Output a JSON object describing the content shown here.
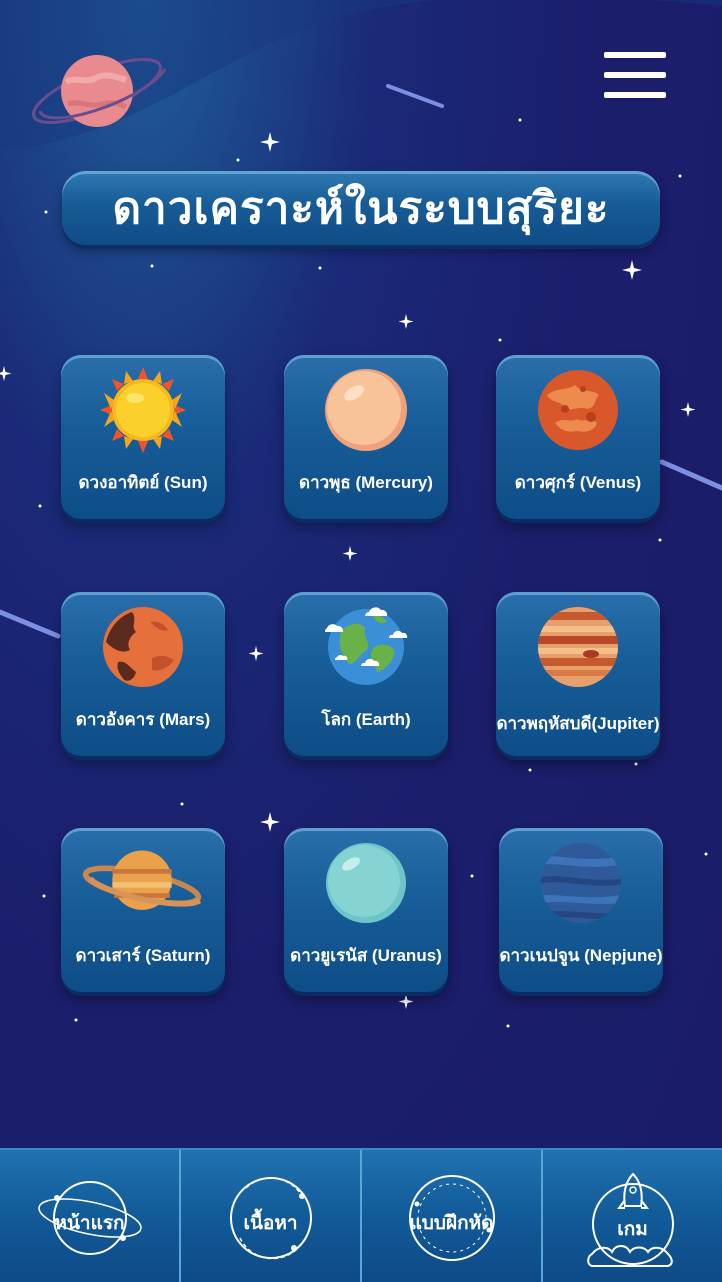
{
  "header": {
    "title": "ดาวเคราะห์ในระบบสุริยะ"
  },
  "planets": [
    {
      "label": "ดวงอาทิตย์ (Sun)",
      "icon": "sun-icon"
    },
    {
      "label": "ดาวพุธ (Mercury)",
      "icon": "mercury-icon"
    },
    {
      "label": "ดาวศุกร์ (Venus)",
      "icon": "venus-icon"
    },
    {
      "label": "ดาวอังคาร (Mars)",
      "icon": "mars-icon"
    },
    {
      "label": "โลก (Earth)",
      "icon": "earth-icon"
    },
    {
      "label": "ดาวพฤหัสบดี(Jupiter)",
      "icon": "jupiter-icon"
    },
    {
      "label": "ดาวเสาร์ (Saturn)",
      "icon": "saturn-icon"
    },
    {
      "label": "ดาวยูเรนัส (Uranus)",
      "icon": "uranus-icon"
    },
    {
      "label": "ดาวเนปจูน (Nepjune)",
      "icon": "neptune-icon"
    }
  ],
  "nav": [
    {
      "label": "หน้าแรก",
      "icon": "home-orbit-icon"
    },
    {
      "label": "เนื้อหา",
      "icon": "content-orbit-icon"
    },
    {
      "label": "แบบฝึกหัด",
      "icon": "exercise-orbit-icon"
    },
    {
      "label": "เกม",
      "icon": "rocket-icon"
    }
  ],
  "colors": {
    "background": "#1b1e6b",
    "card": "#185e99",
    "nav": "#125a98"
  }
}
